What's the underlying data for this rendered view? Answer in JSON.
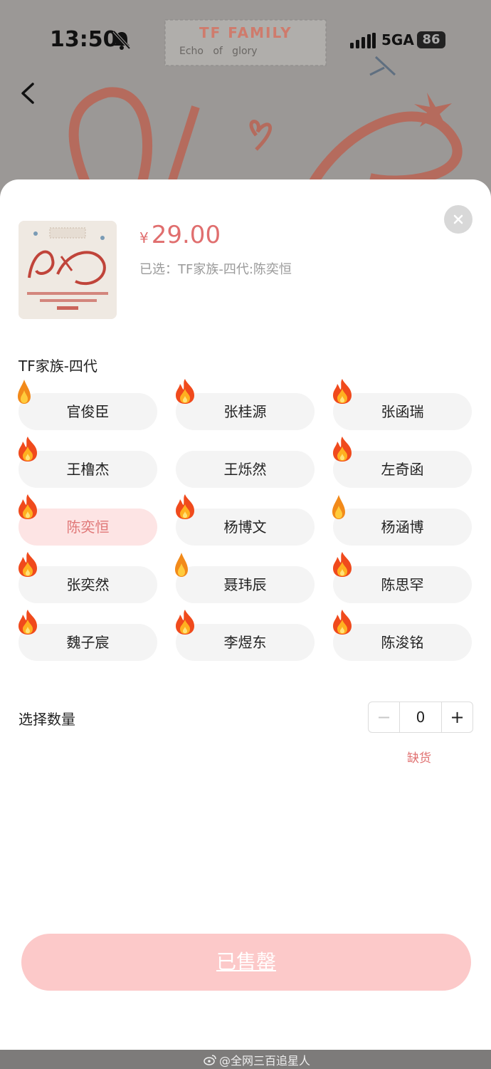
{
  "status_bar": {
    "time": "13:50",
    "network": "5GA",
    "battery": "86"
  },
  "background": {
    "banner_title": "TF FAMILY",
    "banner_subtitle": "Echo   of   glory"
  },
  "product": {
    "currency": "¥",
    "price": "29.00",
    "selected": "已选：TF家族-四代:陈奕恒"
  },
  "group": {
    "title": "TF家族-四代",
    "options": [
      {
        "label": "官俊臣",
        "flame": "small",
        "selected": false
      },
      {
        "label": "张桂源",
        "flame": "big",
        "selected": false
      },
      {
        "label": "张函瑞",
        "flame": "big",
        "selected": false
      },
      {
        "label": "王橹杰",
        "flame": "big",
        "selected": false
      },
      {
        "label": "王烁然",
        "flame": "none",
        "selected": false
      },
      {
        "label": "左奇函",
        "flame": "big",
        "selected": false
      },
      {
        "label": "陈奕恒",
        "flame": "big",
        "selected": true
      },
      {
        "label": "杨博文",
        "flame": "big",
        "selected": false
      },
      {
        "label": "杨涵博",
        "flame": "small",
        "selected": false
      },
      {
        "label": "张奕然",
        "flame": "big",
        "selected": false
      },
      {
        "label": "聂玮辰",
        "flame": "small",
        "selected": false
      },
      {
        "label": "陈思罕",
        "flame": "big",
        "selected": false
      },
      {
        "label": "魏子宸",
        "flame": "big",
        "selected": false
      },
      {
        "label": "李煜东",
        "flame": "big",
        "selected": false
      },
      {
        "label": "陈浚铭",
        "flame": "big",
        "selected": false
      }
    ]
  },
  "quantity": {
    "label": "选择数量",
    "minus": "−",
    "value": "0",
    "plus": "+",
    "stock_status": "缺货"
  },
  "action": {
    "sold_out_label": "已售罄"
  },
  "watermark": "@全网三百追星人",
  "colors": {
    "accent": "#e06e6e",
    "selected_bg": "#fde4e4",
    "button_bg": "#fcc9c9"
  }
}
